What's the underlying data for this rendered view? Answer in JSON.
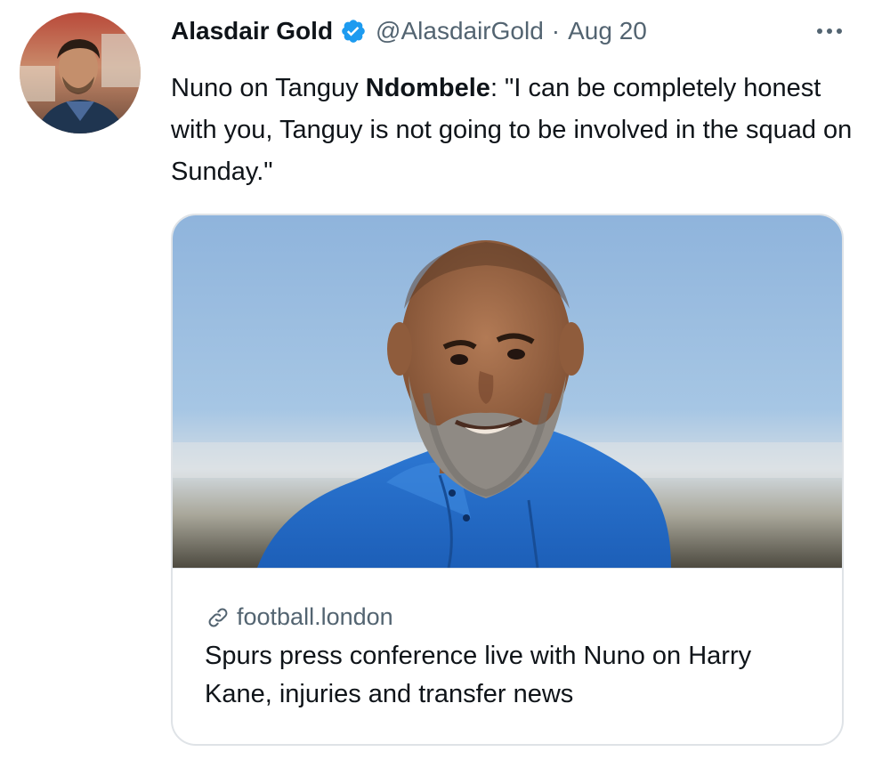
{
  "author": {
    "display_name": "Alasdair Gold",
    "handle": "@AlasdairGold",
    "separator": "·",
    "date": "Aug 20",
    "verified_icon": "verified-badge-icon",
    "avatar": "avatar-photo"
  },
  "more_icon": "more-options-icon",
  "tweet": {
    "text_part1": "Nuno on Tanguy ",
    "text_bold": "Ndombele",
    "text_part2": ": \"I can be completely honest with you, Tanguy is not going to be involved in the squad on Sunday.\""
  },
  "card": {
    "image": "card-photo",
    "link_icon": "link-icon",
    "domain": "football.london",
    "title": "Spurs press conference live with Nuno on Harry Kane, injuries and transfer news"
  },
  "colors": {
    "text_primary": "#0f1419",
    "text_secondary": "#536471",
    "verified_blue": "#1d9bf0",
    "border": "#dfe3e7"
  }
}
